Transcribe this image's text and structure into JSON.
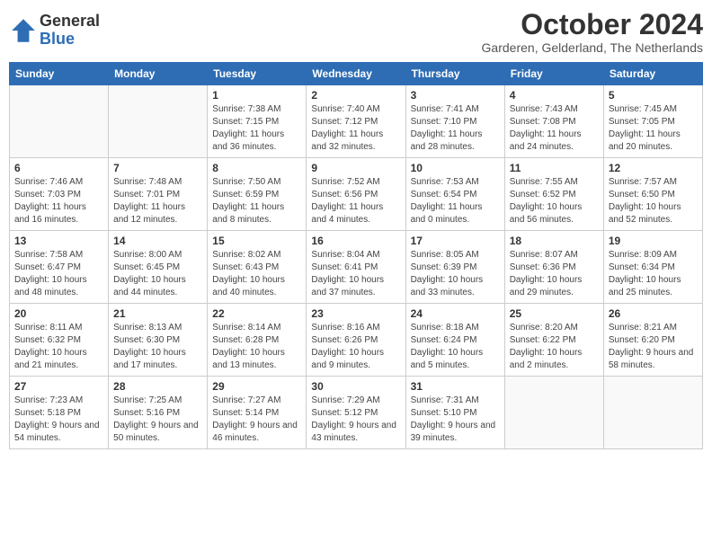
{
  "header": {
    "logo": {
      "general": "General",
      "blue": "Blue"
    },
    "month_year": "October 2024",
    "location": "Garderen, Gelderland, The Netherlands"
  },
  "days_of_week": [
    "Sunday",
    "Monday",
    "Tuesday",
    "Wednesday",
    "Thursday",
    "Friday",
    "Saturday"
  ],
  "weeks": [
    [
      {
        "day": "",
        "sunrise": "",
        "sunset": "",
        "daylight": ""
      },
      {
        "day": "",
        "sunrise": "",
        "sunset": "",
        "daylight": ""
      },
      {
        "day": "1",
        "sunrise": "Sunrise: 7:38 AM",
        "sunset": "Sunset: 7:15 PM",
        "daylight": "Daylight: 11 hours and 36 minutes."
      },
      {
        "day": "2",
        "sunrise": "Sunrise: 7:40 AM",
        "sunset": "Sunset: 7:12 PM",
        "daylight": "Daylight: 11 hours and 32 minutes."
      },
      {
        "day": "3",
        "sunrise": "Sunrise: 7:41 AM",
        "sunset": "Sunset: 7:10 PM",
        "daylight": "Daylight: 11 hours and 28 minutes."
      },
      {
        "day": "4",
        "sunrise": "Sunrise: 7:43 AM",
        "sunset": "Sunset: 7:08 PM",
        "daylight": "Daylight: 11 hours and 24 minutes."
      },
      {
        "day": "5",
        "sunrise": "Sunrise: 7:45 AM",
        "sunset": "Sunset: 7:05 PM",
        "daylight": "Daylight: 11 hours and 20 minutes."
      }
    ],
    [
      {
        "day": "6",
        "sunrise": "Sunrise: 7:46 AM",
        "sunset": "Sunset: 7:03 PM",
        "daylight": "Daylight: 11 hours and 16 minutes."
      },
      {
        "day": "7",
        "sunrise": "Sunrise: 7:48 AM",
        "sunset": "Sunset: 7:01 PM",
        "daylight": "Daylight: 11 hours and 12 minutes."
      },
      {
        "day": "8",
        "sunrise": "Sunrise: 7:50 AM",
        "sunset": "Sunset: 6:59 PM",
        "daylight": "Daylight: 11 hours and 8 minutes."
      },
      {
        "day": "9",
        "sunrise": "Sunrise: 7:52 AM",
        "sunset": "Sunset: 6:56 PM",
        "daylight": "Daylight: 11 hours and 4 minutes."
      },
      {
        "day": "10",
        "sunrise": "Sunrise: 7:53 AM",
        "sunset": "Sunset: 6:54 PM",
        "daylight": "Daylight: 11 hours and 0 minutes."
      },
      {
        "day": "11",
        "sunrise": "Sunrise: 7:55 AM",
        "sunset": "Sunset: 6:52 PM",
        "daylight": "Daylight: 10 hours and 56 minutes."
      },
      {
        "day": "12",
        "sunrise": "Sunrise: 7:57 AM",
        "sunset": "Sunset: 6:50 PM",
        "daylight": "Daylight: 10 hours and 52 minutes."
      }
    ],
    [
      {
        "day": "13",
        "sunrise": "Sunrise: 7:58 AM",
        "sunset": "Sunset: 6:47 PM",
        "daylight": "Daylight: 10 hours and 48 minutes."
      },
      {
        "day": "14",
        "sunrise": "Sunrise: 8:00 AM",
        "sunset": "Sunset: 6:45 PM",
        "daylight": "Daylight: 10 hours and 44 minutes."
      },
      {
        "day": "15",
        "sunrise": "Sunrise: 8:02 AM",
        "sunset": "Sunset: 6:43 PM",
        "daylight": "Daylight: 10 hours and 40 minutes."
      },
      {
        "day": "16",
        "sunrise": "Sunrise: 8:04 AM",
        "sunset": "Sunset: 6:41 PM",
        "daylight": "Daylight: 10 hours and 37 minutes."
      },
      {
        "day": "17",
        "sunrise": "Sunrise: 8:05 AM",
        "sunset": "Sunset: 6:39 PM",
        "daylight": "Daylight: 10 hours and 33 minutes."
      },
      {
        "day": "18",
        "sunrise": "Sunrise: 8:07 AM",
        "sunset": "Sunset: 6:36 PM",
        "daylight": "Daylight: 10 hours and 29 minutes."
      },
      {
        "day": "19",
        "sunrise": "Sunrise: 8:09 AM",
        "sunset": "Sunset: 6:34 PM",
        "daylight": "Daylight: 10 hours and 25 minutes."
      }
    ],
    [
      {
        "day": "20",
        "sunrise": "Sunrise: 8:11 AM",
        "sunset": "Sunset: 6:32 PM",
        "daylight": "Daylight: 10 hours and 21 minutes."
      },
      {
        "day": "21",
        "sunrise": "Sunrise: 8:13 AM",
        "sunset": "Sunset: 6:30 PM",
        "daylight": "Daylight: 10 hours and 17 minutes."
      },
      {
        "day": "22",
        "sunrise": "Sunrise: 8:14 AM",
        "sunset": "Sunset: 6:28 PM",
        "daylight": "Daylight: 10 hours and 13 minutes."
      },
      {
        "day": "23",
        "sunrise": "Sunrise: 8:16 AM",
        "sunset": "Sunset: 6:26 PM",
        "daylight": "Daylight: 10 hours and 9 minutes."
      },
      {
        "day": "24",
        "sunrise": "Sunrise: 8:18 AM",
        "sunset": "Sunset: 6:24 PM",
        "daylight": "Daylight: 10 hours and 5 minutes."
      },
      {
        "day": "25",
        "sunrise": "Sunrise: 8:20 AM",
        "sunset": "Sunset: 6:22 PM",
        "daylight": "Daylight: 10 hours and 2 minutes."
      },
      {
        "day": "26",
        "sunrise": "Sunrise: 8:21 AM",
        "sunset": "Sunset: 6:20 PM",
        "daylight": "Daylight: 9 hours and 58 minutes."
      }
    ],
    [
      {
        "day": "27",
        "sunrise": "Sunrise: 7:23 AM",
        "sunset": "Sunset: 5:18 PM",
        "daylight": "Daylight: 9 hours and 54 minutes."
      },
      {
        "day": "28",
        "sunrise": "Sunrise: 7:25 AM",
        "sunset": "Sunset: 5:16 PM",
        "daylight": "Daylight: 9 hours and 50 minutes."
      },
      {
        "day": "29",
        "sunrise": "Sunrise: 7:27 AM",
        "sunset": "Sunset: 5:14 PM",
        "daylight": "Daylight: 9 hours and 46 minutes."
      },
      {
        "day": "30",
        "sunrise": "Sunrise: 7:29 AM",
        "sunset": "Sunset: 5:12 PM",
        "daylight": "Daylight: 9 hours and 43 minutes."
      },
      {
        "day": "31",
        "sunrise": "Sunrise: 7:31 AM",
        "sunset": "Sunset: 5:10 PM",
        "daylight": "Daylight: 9 hours and 39 minutes."
      },
      {
        "day": "",
        "sunrise": "",
        "sunset": "",
        "daylight": ""
      },
      {
        "day": "",
        "sunrise": "",
        "sunset": "",
        "daylight": ""
      }
    ]
  ]
}
